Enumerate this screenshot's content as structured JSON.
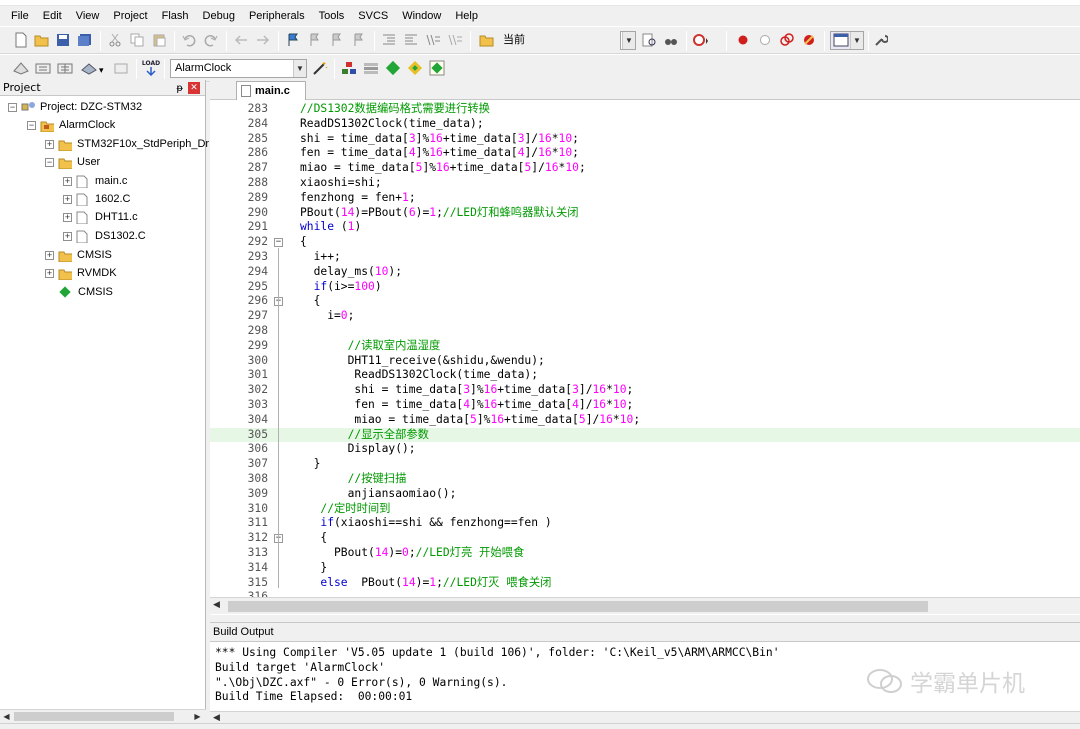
{
  "menu": [
    "File",
    "Edit",
    "View",
    "Project",
    "Flash",
    "Debug",
    "Peripherals",
    "Tools",
    "SVCS",
    "Window",
    "Help"
  ],
  "toolbar1": {
    "combo_value": "当前"
  },
  "toolbar2": {
    "target_value": "AlarmClock",
    "load_label": "LOAD"
  },
  "project_pane": {
    "title": "Project",
    "pin": "ᵽ",
    "close": "✕",
    "tree": [
      {
        "label": "Project: DZC-STM32",
        "icon": "project-icon",
        "expander": "⊟"
      },
      {
        "label": "AlarmClock",
        "icon": "target-folder-icon",
        "expander": "⊟"
      },
      {
        "label": "STM32F10x_StdPeriph_Dr",
        "icon": "folder-icon",
        "expander": "⊞"
      },
      {
        "label": "User",
        "icon": "folder-icon",
        "expander": "⊟"
      },
      {
        "label": "main.c",
        "icon": "file-icon",
        "expander": "⊞"
      },
      {
        "label": "1602.C",
        "icon": "file-icon",
        "expander": "⊞"
      },
      {
        "label": "DHT11.c",
        "icon": "file-icon",
        "expander": "⊞"
      },
      {
        "label": "DS1302.C",
        "icon": "file-icon",
        "expander": "⊞"
      },
      {
        "label": "CMSIS",
        "icon": "folder-icon",
        "expander": "⊞"
      },
      {
        "label": "RVMDK",
        "icon": "folder-icon",
        "expander": "⊞"
      },
      {
        "label": "CMSIS",
        "icon": "green-diamond-icon",
        "expander": ""
      }
    ]
  },
  "editor": {
    "tab_label": "main.c",
    "lines": [
      {
        "n": "283",
        "fold": "",
        "text": "//DS1302数据编码格式需要进行转换",
        "kind": "comment",
        "indent": 0
      },
      {
        "n": "284",
        "fold": "",
        "text": "ReadDS1302Clock(time_data);",
        "kind": "plain",
        "indent": 0
      },
      {
        "n": "285",
        "fold": "",
        "text": "shi = time_data[3]%16+time_data[3]/16*10;",
        "kind": "plain",
        "indent": 0
      },
      {
        "n": "286",
        "fold": "",
        "text": "fen = time_data[4]%16+time_data[4]/16*10;",
        "kind": "plain",
        "indent": 0
      },
      {
        "n": "287",
        "fold": "",
        "text": "miao = time_data[5]%16+time_data[5]/16*10;",
        "kind": "plain",
        "indent": 0
      },
      {
        "n": "288",
        "fold": "",
        "text": "xiaoshi=shi;",
        "kind": "plain",
        "indent": 0
      },
      {
        "n": "289",
        "fold": "",
        "text": "fenzhong = fen+1;",
        "kind": "plain",
        "indent": 0
      },
      {
        "n": "290",
        "fold": "",
        "text": "PBout(14)=PBout(6)=1;//LED灯和蜂鸣器默认关闭",
        "kind": "mixed-comment",
        "indent": 0
      },
      {
        "n": "291",
        "fold": "",
        "text": "while (1)",
        "kind": "keyword",
        "indent": 0
      },
      {
        "n": "292",
        "fold": "⊟",
        "text": "{",
        "kind": "plain",
        "indent": 0
      },
      {
        "n": "293",
        "fold": "",
        "text": "i++;",
        "kind": "plain",
        "indent": 2
      },
      {
        "n": "294",
        "fold": "",
        "text": "delay_ms(10);",
        "kind": "plain",
        "indent": 2
      },
      {
        "n": "295",
        "fold": "",
        "text": "if(i>=100)",
        "kind": "keyword",
        "indent": 2
      },
      {
        "n": "296",
        "fold": "⊟",
        "text": "{",
        "kind": "plain",
        "indent": 2
      },
      {
        "n": "297",
        "fold": "",
        "text": "i=0;",
        "kind": "plain",
        "indent": 4
      },
      {
        "n": "298",
        "fold": "",
        "text": "",
        "kind": "plain",
        "indent": 0
      },
      {
        "n": "299",
        "fold": "",
        "text": "//读取室内温湿度",
        "kind": "comment",
        "indent": 7
      },
      {
        "n": "300",
        "fold": "",
        "text": "DHT11_receive(&shidu,&wendu);",
        "kind": "plain",
        "indent": 7
      },
      {
        "n": "301",
        "fold": "",
        "text": "ReadDS1302Clock(time_data);",
        "kind": "plain",
        "indent": 8
      },
      {
        "n": "302",
        "fold": "",
        "text": "shi = time_data[3]%16+time_data[3]/16*10;",
        "kind": "plain",
        "indent": 8
      },
      {
        "n": "303",
        "fold": "",
        "text": "fen = time_data[4]%16+time_data[4]/16*10;",
        "kind": "plain",
        "indent": 8
      },
      {
        "n": "304",
        "fold": "",
        "text": "miao = time_data[5]%16+time_data[5]/16*10;",
        "kind": "plain",
        "indent": 8
      },
      {
        "n": "305",
        "fold": "",
        "text": "//显示全部参数",
        "kind": "comment",
        "indent": 7,
        "highlight": true
      },
      {
        "n": "306",
        "fold": "",
        "text": "Display();",
        "kind": "plain",
        "indent": 7
      },
      {
        "n": "307",
        "fold": "",
        "text": "}",
        "kind": "plain",
        "indent": 2
      },
      {
        "n": "308",
        "fold": "",
        "text": "//按键扫描",
        "kind": "comment",
        "indent": 7
      },
      {
        "n": "309",
        "fold": "",
        "text": "anjiansaomiao();",
        "kind": "plain",
        "indent": 7
      },
      {
        "n": "310",
        "fold": "",
        "text": "//定时时间到",
        "kind": "comment",
        "indent": 3
      },
      {
        "n": "311",
        "fold": "",
        "text": "if(xiaoshi==shi && fenzhong==fen )",
        "kind": "keyword",
        "indent": 3
      },
      {
        "n": "312",
        "fold": "⊟",
        "text": "{",
        "kind": "plain",
        "indent": 3
      },
      {
        "n": "313",
        "fold": "",
        "text": "PBout(14)=0;//LED灯亮 开始喂食",
        "kind": "mixed-comment",
        "indent": 5
      },
      {
        "n": "314",
        "fold": "",
        "text": "}",
        "kind": "plain",
        "indent": 3
      },
      {
        "n": "315",
        "fold": "",
        "text": "else  PBout(14)=1;//LED灯灭 喂食关闭",
        "kind": "else-comment",
        "indent": 3
      },
      {
        "n": "316",
        "fold": "",
        "text": "",
        "kind": "plain",
        "indent": 0
      }
    ]
  },
  "build_output": {
    "title": "Build Output",
    "lines": [
      "*** Using Compiler 'V5.05 update 1 (build 106)', folder: 'C:\\Keil_v5\\ARM\\ARMCC\\Bin'",
      "Build target 'AlarmClock'",
      "\".\\Obj\\DZC.axf\" - 0 Error(s), 0 Warning(s).",
      "Build Time Elapsed:  00:00:01"
    ]
  },
  "watermark": {
    "text": "学霸单片机"
  },
  "colors": {
    "comment": "#009900",
    "keyword": "#0000cc",
    "number": "#ff00ff",
    "highlight_line": "#e6f7e6"
  }
}
